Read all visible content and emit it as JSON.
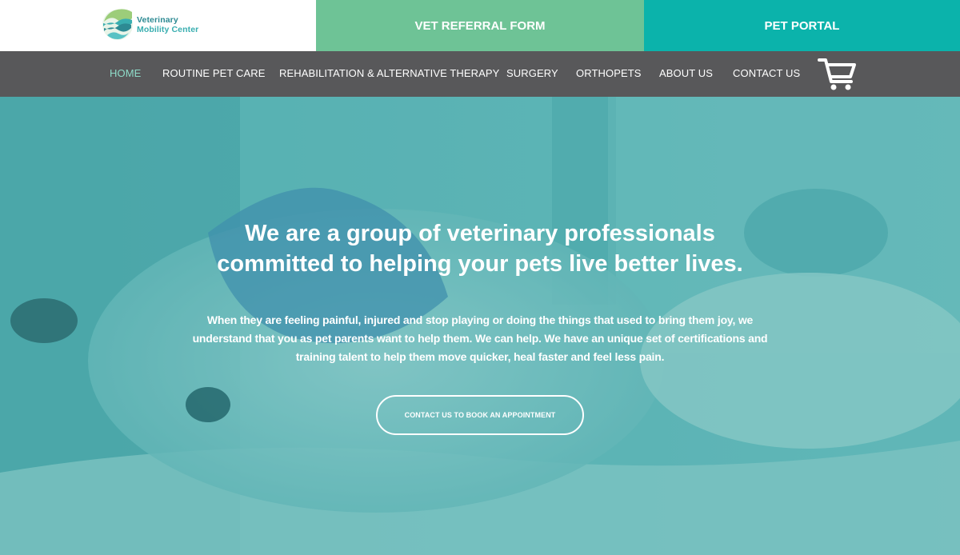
{
  "brand": {
    "line1": "Veterinary",
    "line2": "Mobility Center"
  },
  "topbar": {
    "referral_label": "VET REFERRAL FORM",
    "portal_label": "PET PORTAL"
  },
  "nav": {
    "items": [
      {
        "label": "HOME",
        "active": true
      },
      {
        "label": "ROUTINE PET CARE"
      },
      {
        "label": "REHABILITATION & ALTERNATIVE THERAPY"
      },
      {
        "label": "SURGERY"
      },
      {
        "label": "ORTHOPETS"
      },
      {
        "label": "ABOUT US"
      },
      {
        "label": "CONTACT US"
      }
    ],
    "cart_icon": "shopping-cart-icon"
  },
  "hero": {
    "headline_1": "We are a group of veterinary professionals",
    "headline_2": "committed to helping your pets live better lives.",
    "para_1": "When they are feeling painful, injured and stop playing or doing the things that used to bring them joy, we",
    "para_2": "understand that you as pet parents want to help them. We can help. We have an unique set of certifications and",
    "para_3": "training talent to help them move quicker, heal faster and feel less pain.",
    "cta_label": "CONTACT US TO BOOK AN APPOINTMENT"
  },
  "colors": {
    "referral_bg": "#6ec396",
    "portal_bg": "#0bb3ab",
    "nav_bg": "#58585a",
    "nav_active": "#8fdcc9",
    "hero_tint": "#5fb1b2"
  }
}
